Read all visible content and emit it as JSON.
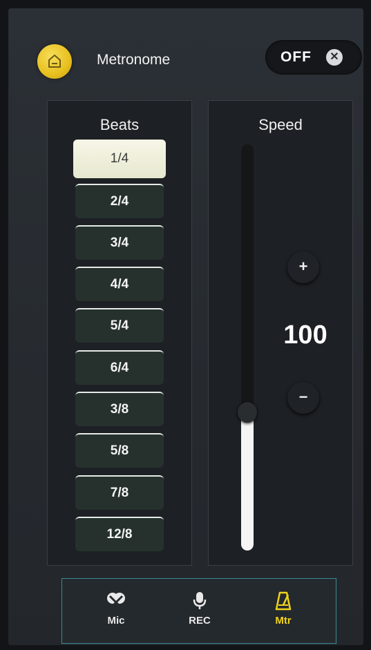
{
  "header": {
    "title": "Metronome",
    "toggle_label": "OFF",
    "toggle_close": "✕"
  },
  "beats": {
    "title": "Beats",
    "selected_index": 0,
    "items": [
      "1/4",
      "2/4",
      "3/4",
      "4/4",
      "5/4",
      "6/4",
      "3/8",
      "5/8",
      "7/8",
      "12/8"
    ]
  },
  "speed": {
    "title": "Speed",
    "value": "100",
    "plus_label": "+",
    "minus_label": "−",
    "slider_level": 0.34
  },
  "nav": {
    "items": [
      {
        "label": "Mic",
        "icon": "microphone-cross-icon",
        "active": false
      },
      {
        "label": "REC",
        "icon": "microphone-icon",
        "active": false
      },
      {
        "label": "Mtr",
        "icon": "metronome-icon",
        "active": true
      }
    ]
  },
  "colors": {
    "accent": "#f1d31b",
    "nav_border": "#3c8a92",
    "home_button": "#e7bf1e"
  }
}
